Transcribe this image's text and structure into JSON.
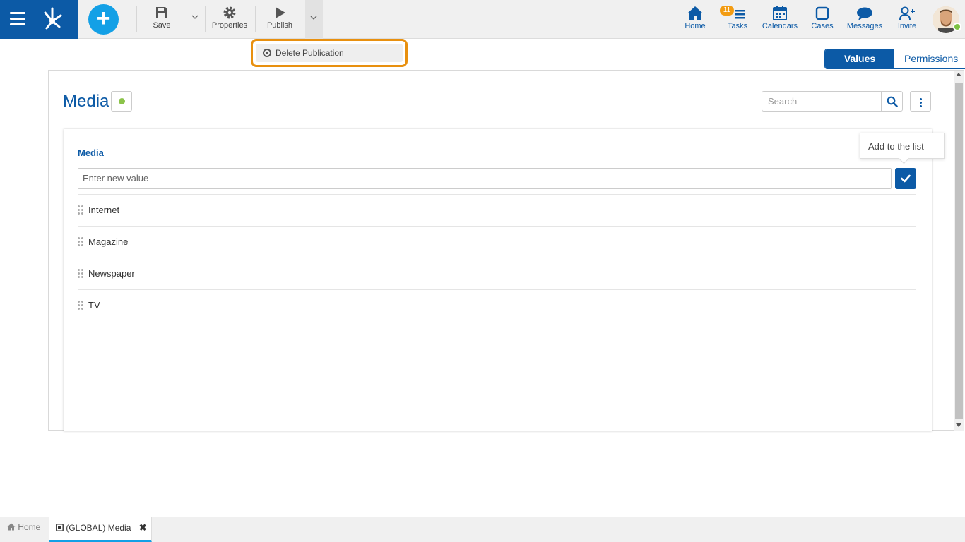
{
  "toolbar": {
    "save_label": "Save",
    "properties_label": "Properties",
    "publish_label": "Publish"
  },
  "nav": {
    "home": "Home",
    "tasks": "Tasks",
    "tasks_badge": "11",
    "calendars": "Calendars",
    "cases": "Cases",
    "messages": "Messages",
    "invite": "Invite"
  },
  "dropdown": {
    "delete_publication": "Delete Publication"
  },
  "view_tabs": {
    "values": "Values",
    "permissions": "Permissions"
  },
  "main": {
    "title": "Media",
    "search_placeholder": "Search",
    "field_label": "Media",
    "new_value_placeholder": "Enter new value",
    "tooltip": "Add to the list",
    "items": [
      "Internet",
      "Magazine",
      "Newspaper",
      "TV"
    ]
  },
  "bottom_tabs": {
    "home": "Home",
    "current": "(GLOBAL) Media"
  },
  "colors": {
    "brand_blue": "#0c5aa6",
    "accent_cyan": "#13a0e6",
    "highlight_orange": "#e8900f",
    "status_green": "#8bc34a",
    "badge_orange": "#f39c12"
  }
}
